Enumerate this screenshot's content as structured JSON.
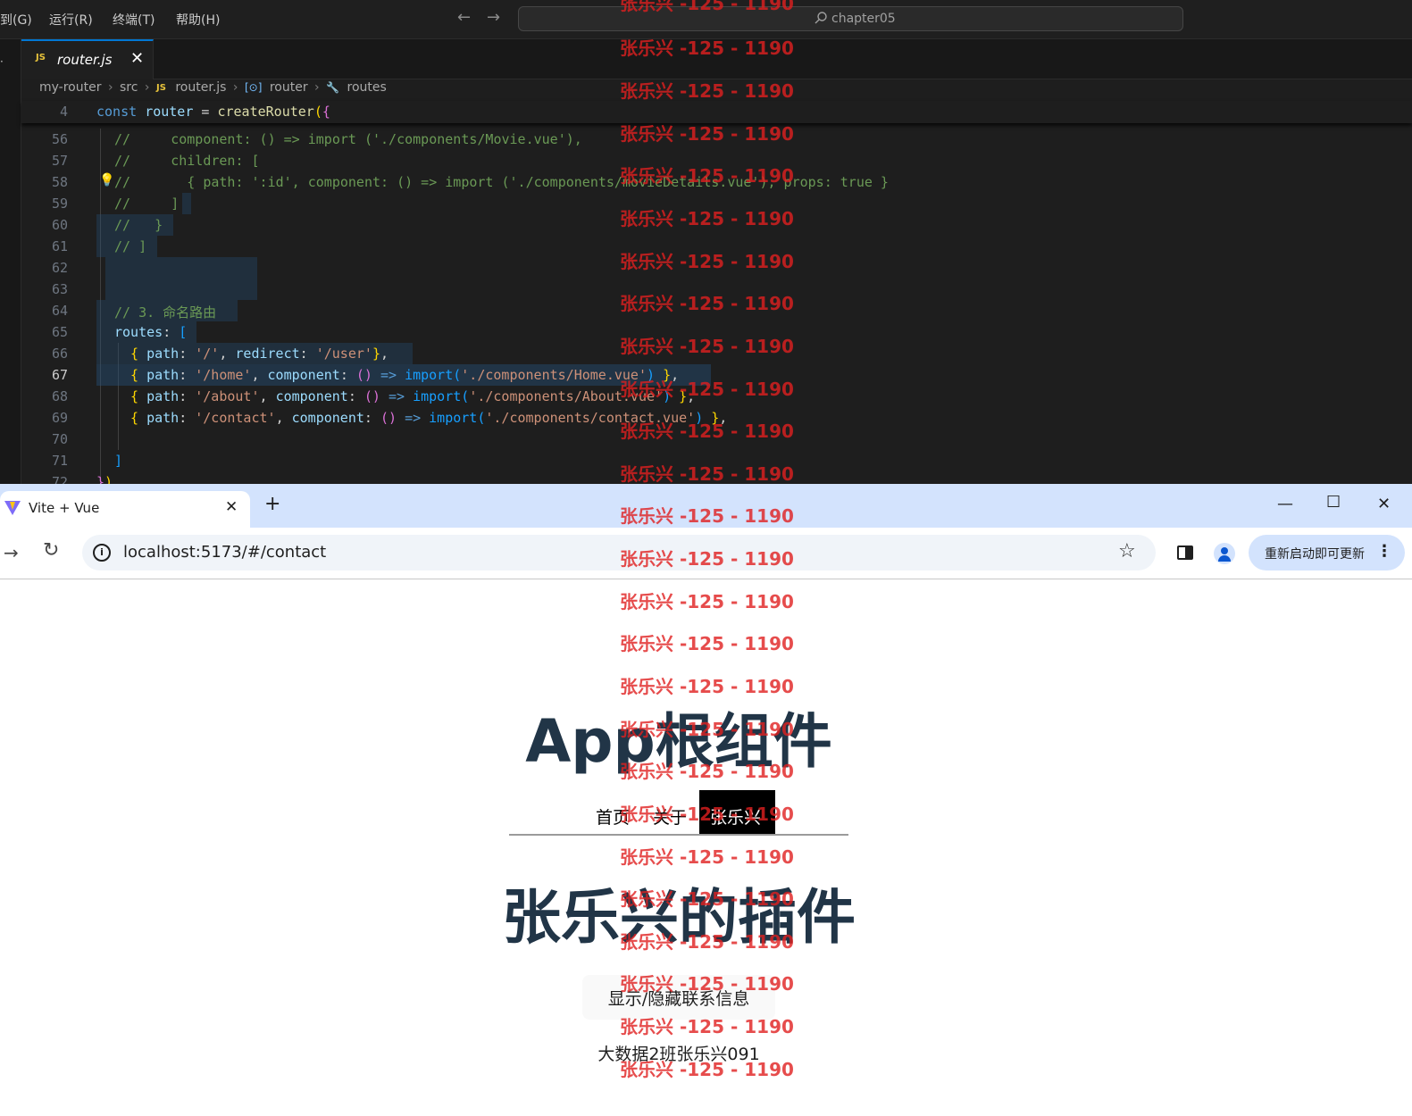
{
  "vscode": {
    "menu": [
      "到(G)",
      "运行(R)",
      "终端(T)",
      "帮助(H)"
    ],
    "search_text": "chapter05",
    "tab": {
      "icon": "JS",
      "name": "router.js"
    },
    "breadcrumb": [
      "my-router",
      "src",
      "router.js",
      "router",
      "routes"
    ],
    "sticky": {
      "line": "4",
      "text": "const router = createRouter({"
    },
    "line_numbers": [
      "56",
      "57",
      "58",
      "59",
      "60",
      "61",
      "62",
      "63",
      "64",
      "65",
      "66",
      "67",
      "68",
      "69",
      "70",
      "71",
      "72"
    ],
    "active_line": "67",
    "lines": {
      "l56": "//     component: () => import ('./components/Movie.vue'),",
      "l57": "//     children: [",
      "l58": "//       { path: ':id', component: () => import ('./components/movieDetails.vue'), props: true }",
      "l59": "//     ]",
      "l60": "//   }",
      "l61": "// ]",
      "l64": "// 3. 命名路由",
      "l65_key": "routes",
      "l66_a": "path",
      "l66_b": "'/'",
      "l66_c": "redirect",
      "l66_d": "'/user'",
      "l67_path": "'/home'",
      "l67_mod": "'./components/Home.vue'",
      "l68_path": "'/about'",
      "l68_mod": "'./components/About.vue'",
      "l69_path": "'/contact'",
      "l69_mod": "'./components/contact.vue'",
      "kw_path": "path",
      "kw_component": "component",
      "kw_import": "import"
    }
  },
  "chrome": {
    "tab_title": "Vite + Vue",
    "url": "localhost:5173/#/contact",
    "update_label": "重新启动即可更新"
  },
  "page": {
    "app_title": "App根组件",
    "nav": [
      "首页",
      "关于",
      "张乐兴"
    ],
    "plugin_title": "张乐兴的插件",
    "toggle_button": "显示/隐藏联系信息",
    "info_text": "大数据2班张乐兴091"
  },
  "watermark": {
    "text": "张乐兴 -125 - 1190"
  },
  "colors": {
    "accent": "#0078d4",
    "watermark": "#e02020",
    "heading": "#213547",
    "chrome_tabbar": "#d3e3fd"
  }
}
